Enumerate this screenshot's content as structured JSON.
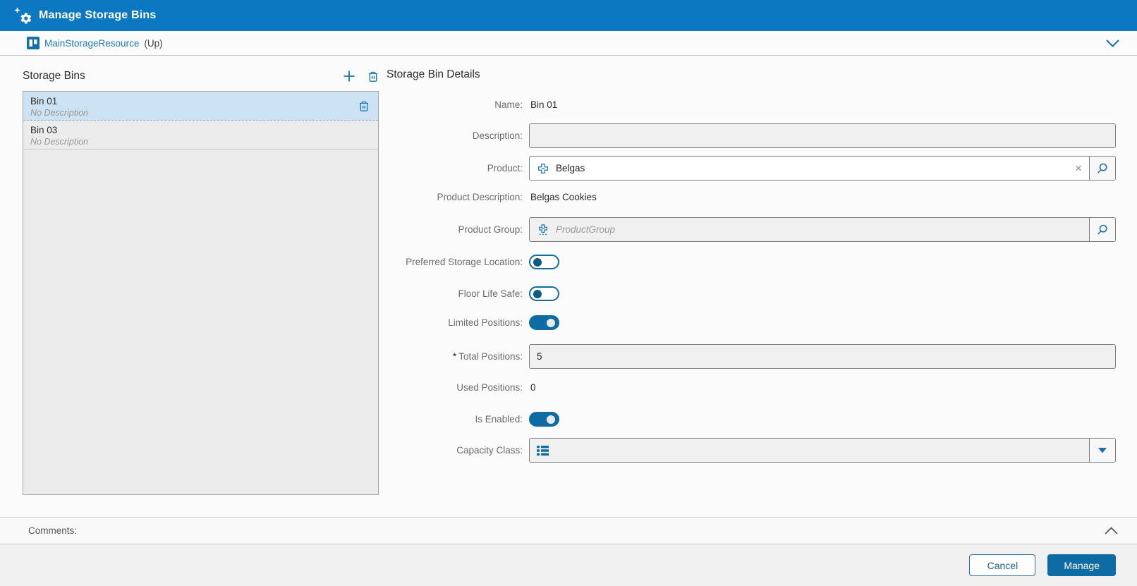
{
  "header": {
    "title": "Manage Storage Bins"
  },
  "breadcrumb": {
    "resource": "MainStorageResource",
    "direction": "(Up)"
  },
  "bins": {
    "title": "Storage Bins",
    "items": [
      {
        "name": "Bin 01",
        "description": "No Description",
        "selected": true
      },
      {
        "name": "Bin 03",
        "description": "No Description",
        "selected": false
      }
    ]
  },
  "details": {
    "title": "Storage Bin Details",
    "name": {
      "label": "Name:",
      "value": "Bin 01"
    },
    "description": {
      "label": "Description:",
      "value": ""
    },
    "product": {
      "label": "Product:",
      "value": "Belgas",
      "clear": "×"
    },
    "product_description": {
      "label": "Product Description:",
      "value": "Belgas Cookies"
    },
    "product_group": {
      "label": "Product Group:",
      "placeholder": "ProductGroup",
      "value": ""
    },
    "preferred_storage_location": {
      "label": "Preferred Storage Location:",
      "value": false
    },
    "floor_life_safe": {
      "label": "Floor Life Safe:",
      "value": false
    },
    "limited_positions": {
      "label": "Limited Positions:",
      "value": true
    },
    "total_positions": {
      "label": "Total Positions:",
      "required_marker": "*",
      "value": "5"
    },
    "used_positions": {
      "label": "Used Positions:",
      "value": "0"
    },
    "is_enabled": {
      "label": "Is Enabled:",
      "value": true
    },
    "capacity_class": {
      "label": "Capacity Class:",
      "value": ""
    }
  },
  "comments": {
    "label": "Comments:"
  },
  "footer": {
    "cancel_label": "Cancel",
    "manage_label": "Manage"
  },
  "icons": {
    "header": "gear-with-sparkle",
    "resource": "storage-resource-board",
    "resource_expander": "chevron-down",
    "add_bin": "plus",
    "delete_bins": "trash",
    "row_delete": "trash",
    "product": "product-cross",
    "product_clear": "x",
    "search": "magnifier",
    "product_group": "product-group-cross-dots",
    "capacity_class": "list",
    "capacity_dropdown": "caret-down",
    "comments_collapse": "chevron-up"
  },
  "colors": {
    "header_blue": "#0c78c1",
    "accent_blue": "#0f6ba3",
    "icon_blue": "#1b74b3",
    "link_blue": "#2079ba",
    "selected_row": "#cde2f2"
  }
}
